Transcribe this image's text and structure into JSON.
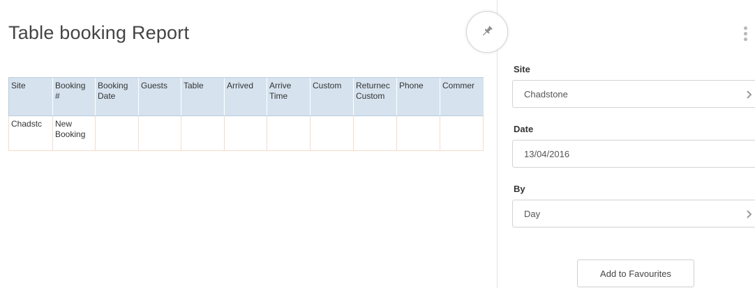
{
  "page": {
    "title": "Table booking Report"
  },
  "table": {
    "columns": [
      "Site",
      "Booking #",
      "Booking Date",
      "Guests",
      "Table",
      "Arrived",
      "Arrive Time",
      "Customer",
      "Returned Customer",
      "Phone",
      "Comments"
    ],
    "column_display": [
      "Site",
      "Booking\n#",
      "Booking\nDate",
      "Guests",
      "Table",
      "Arrived",
      "Arrive\nTime",
      "Custom",
      "Returnec\nCustom",
      "Phone",
      "Commer"
    ],
    "rows": [
      {
        "cells": [
          "Chadstone",
          "New Booking",
          "",
          "",
          "",
          "",
          "",
          "",
          "",
          "",
          ""
        ],
        "display": [
          "Chadstc",
          "New\nBooking",
          "",
          "",
          "",
          "",
          "",
          "",
          "",
          "",
          ""
        ]
      }
    ]
  },
  "filters": {
    "site": {
      "label": "Site",
      "value": "Chadstone"
    },
    "date": {
      "label": "Date",
      "value": "13/04/2016"
    },
    "by": {
      "label": "By",
      "value": "Day"
    }
  },
  "actions": {
    "add_to_favourites": "Add to Favourites"
  },
  "icons": {
    "pin": "pin-icon",
    "menu": "vertical-dots-menu-icon",
    "chevron": "chevron-right-icon"
  },
  "colors": {
    "header_bg": "#d6e3ef",
    "row_border": "#f3dccd"
  }
}
